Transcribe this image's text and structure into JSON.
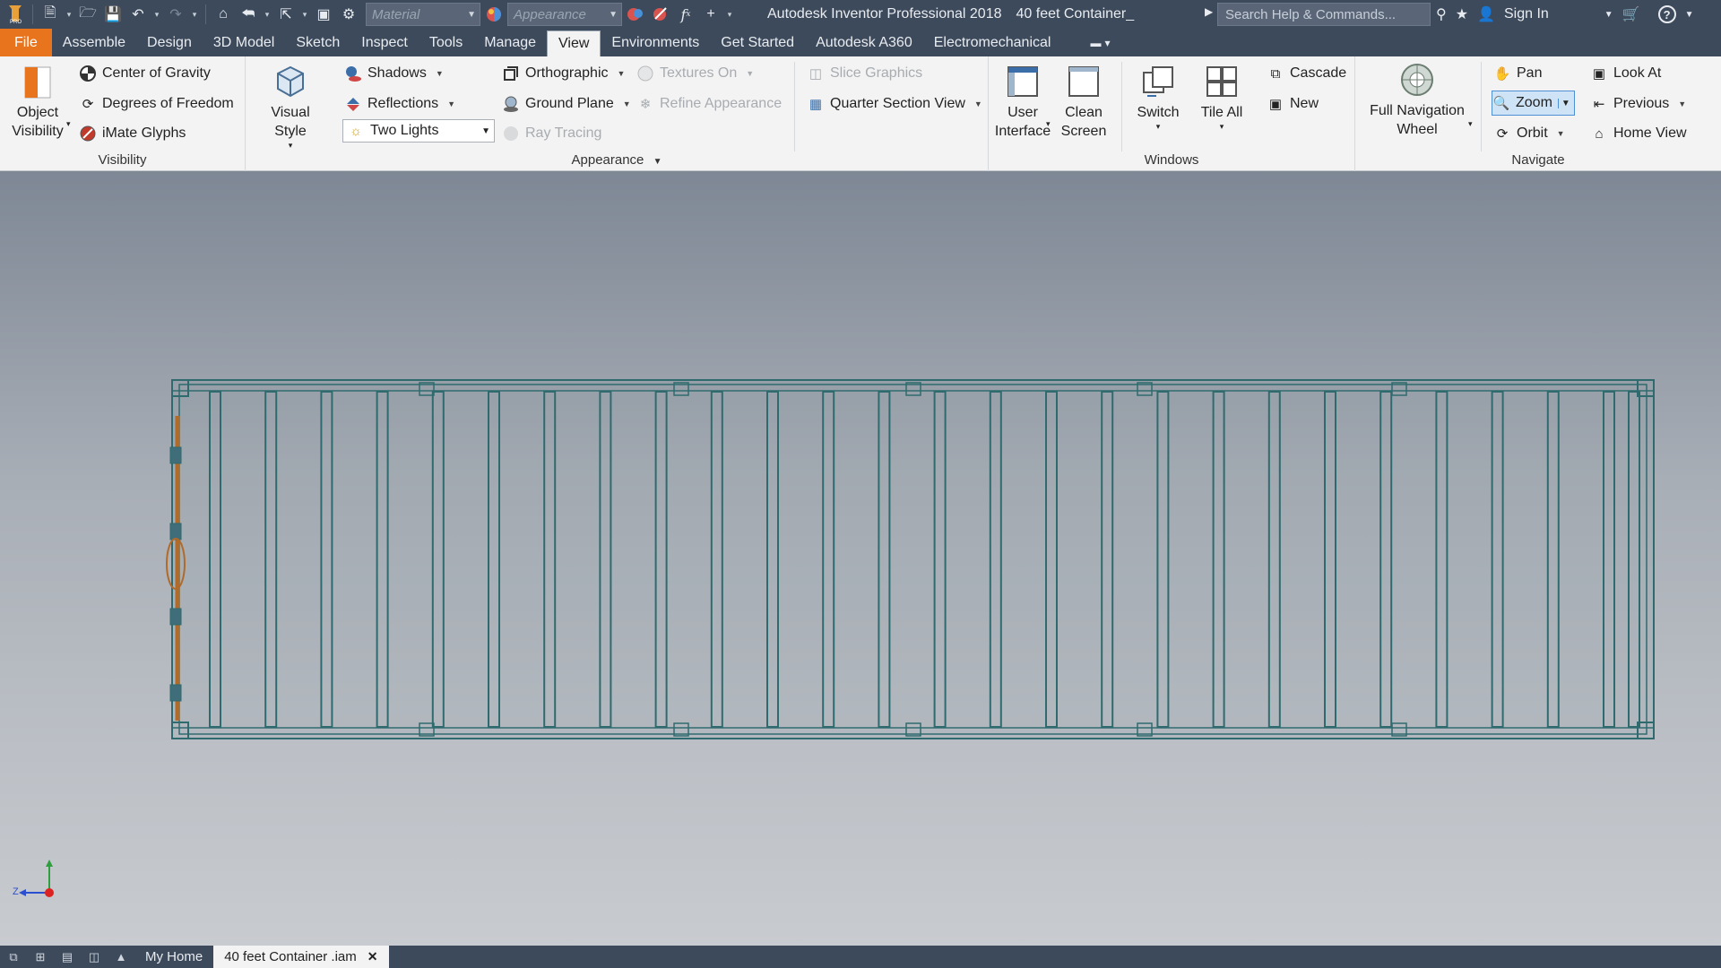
{
  "titlebar": {
    "material_placeholder": "Material",
    "appearance_placeholder": "Appearance",
    "app_name": "Autodesk Inventor Professional 2018",
    "doc_name": "40 feet Container_",
    "search_placeholder": "Search Help & Commands...",
    "sign_in": "Sign In"
  },
  "tabs": [
    "File",
    "Assemble",
    "Design",
    "3D Model",
    "Sketch",
    "Inspect",
    "Tools",
    "Manage",
    "View",
    "Environments",
    "Get Started",
    "Autodesk A360",
    "Electromechanical"
  ],
  "active_tab": "View",
  "ribbon": {
    "visibility": {
      "title": "Visibility",
      "object_visibility": "Object Visibility",
      "center_of_gravity": "Center of Gravity",
      "degrees_of_freedom": "Degrees of Freedom",
      "imate_glyphs": "iMate Glyphs"
    },
    "appearance": {
      "title": "Appearance",
      "visual_style": "Visual Style",
      "shadows": "Shadows",
      "reflections": "Reflections",
      "lighting": "Two Lights",
      "orthographic": "Orthographic",
      "ground_plane": "Ground Plane",
      "ray_tracing": "Ray Tracing",
      "textures_on": "Textures On",
      "refine_appearance": "Refine Appearance",
      "slice_graphics": "Slice Graphics",
      "quarter_section_view": "Quarter Section View"
    },
    "windows": {
      "title": "Windows",
      "user_interface": "User Interface",
      "clean_screen": "Clean Screen",
      "switch": "Switch",
      "tile_all": "Tile All",
      "cascade": "Cascade",
      "new": "New"
    },
    "navigate": {
      "title": "Navigate",
      "full_navigation_wheel": "Full Navigation Wheel",
      "pan": "Pan",
      "zoom": "Zoom",
      "orbit": "Orbit",
      "look_at": "Look At",
      "previous": "Previous",
      "home_view": "Home View"
    }
  },
  "viewport": {
    "axis_label": "Z",
    "model_color": "#2f6b6e",
    "door_color": "#b06a2a"
  },
  "bottom_tabs": {
    "home": "My Home",
    "document": "40 feet Container .iam"
  },
  "colors": {
    "titlebar": "#3d4a5c",
    "file_tab": "#e8741e",
    "ribbon": "#f3f3f3"
  }
}
